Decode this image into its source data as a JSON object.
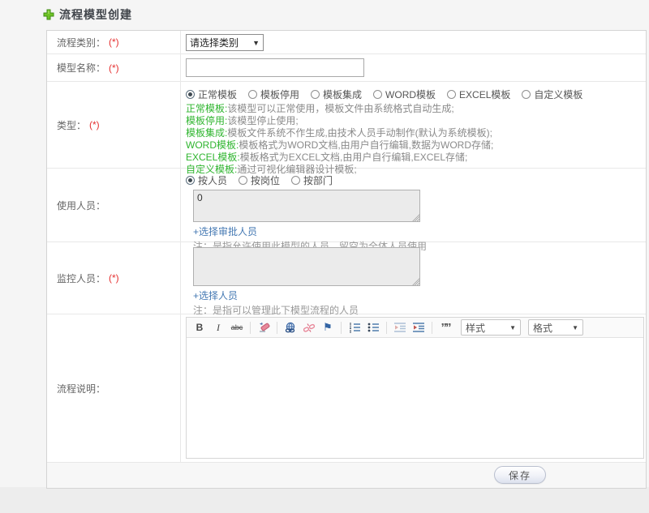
{
  "header": {
    "title": "流程模型创建"
  },
  "labels": {
    "required": "(*)",
    "category": "流程类别：",
    "name": "模型名称：",
    "type": "类型：",
    "users": "使用人员：",
    "monitors": "监控人员：",
    "description": "流程说明："
  },
  "category": {
    "select_value": "请选择类别",
    "caret": "▼"
  },
  "name": {
    "input_value": ""
  },
  "type": {
    "options": [
      {
        "label": "正常模板",
        "selected": true
      },
      {
        "label": "模板停用",
        "selected": false
      },
      {
        "label": "模板集成",
        "selected": false
      },
      {
        "label": "WORD模板",
        "selected": false
      },
      {
        "label": "EXCEL模板",
        "selected": false
      },
      {
        "label": "自定义模板",
        "selected": false
      }
    ],
    "descriptions": [
      {
        "term": "正常模板:",
        "text": "该模型可以正常使用，模板文件由系统格式自动生成;"
      },
      {
        "term": "模板停用:",
        "text": "该模型停止使用;"
      },
      {
        "term": "模板集成:",
        "text": "模板文件系统不作生成,由技术人员手动制作(默认为系统模板);"
      },
      {
        "term": "WORD模板:",
        "text": "模板格式为WORD文档,由用户自行编辑,数据为WORD存储;"
      },
      {
        "term": "EXCEL模板:",
        "text": "模板格式为EXCEL文档,由用户自行编辑,EXCEL存储;"
      },
      {
        "term": "自定义模板:",
        "text": "通过可视化编辑器设计模板;"
      }
    ]
  },
  "users": {
    "modes": [
      {
        "label": "按人员",
        "selected": true
      },
      {
        "label": "按岗位",
        "selected": false
      },
      {
        "label": "按部门",
        "selected": false
      }
    ],
    "textarea_value": "0",
    "link": "+选择审批人员",
    "note": "注：是指允许使用此模型的人员，留空为全体人员使用"
  },
  "monitors": {
    "textarea_value": "",
    "link": "+选择人员",
    "note": "注：是指可以管理此下模型流程的人员"
  },
  "editor": {
    "bold": "B",
    "italic": "I",
    "strike": "abc",
    "blockquote": "””",
    "styles_label": "样式",
    "format_label": "格式",
    "caret": "▼"
  },
  "footer": {
    "save_label": "保存"
  },
  "colors": {
    "accent_green": "#2fb52f",
    "required_red": "#e53030",
    "link_blue": "#4579b3",
    "toolbar_icon_blue": "#3b67a5",
    "toolbar_icon_pink": "#e8899b"
  }
}
